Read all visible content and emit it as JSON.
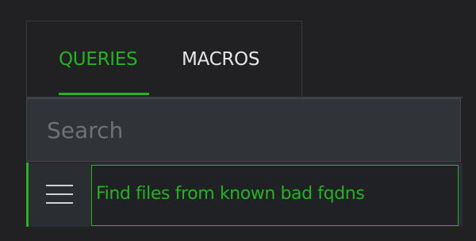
{
  "tabs": [
    {
      "label": "QUERIES",
      "active": true
    },
    {
      "label": "MACROS",
      "active": false
    }
  ],
  "search": {
    "placeholder": "Search",
    "value": ""
  },
  "list": {
    "items": [
      {
        "label": "Find files from known bad fqdns",
        "icon": "hamburger-menu-icon"
      }
    ]
  },
  "colors": {
    "accent": "#25b322",
    "background": "#212124",
    "panel": "#2a2d31",
    "input_background": "#303438",
    "text": "#e6e6e6",
    "placeholder": "#6e7277"
  }
}
